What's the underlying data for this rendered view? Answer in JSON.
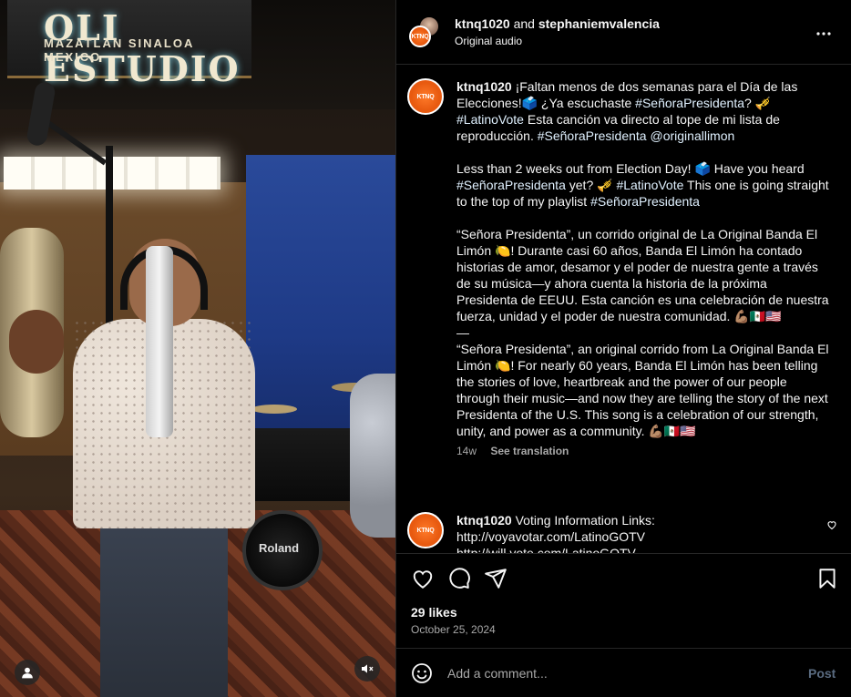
{
  "media": {
    "studio_sign_title": "OLI ESTUDIO",
    "studio_sign_subtitle": "MAZATLAN SINALOA MEXICO",
    "drum_brand": "Roland",
    "user_icon": "person-icon",
    "mute_icon": "speaker-muted-icon"
  },
  "header": {
    "user1": "ktnq1020",
    "joiner": "and",
    "user2": "stephaniemvalencia",
    "audio": "Original audio",
    "avatar_text": "KTNQ",
    "more_icon": "more-horizontal-icon"
  },
  "caption": {
    "user": "ktnq1020",
    "avatar_text": "KTNQ",
    "p1": [
      {
        "t": "text",
        "v": "¡Faltan menos de dos semanas para el Día de las Elecciones!🗳️ ¿Ya escuchaste "
      },
      {
        "t": "tag",
        "v": "#SeñoraPresidenta"
      },
      {
        "t": "text",
        "v": "? 🎺 "
      },
      {
        "t": "tag",
        "v": "#LatinoVote"
      },
      {
        "t": "text",
        "v": " Esta canción va directo al tope de mi lista de reproducción. "
      },
      {
        "t": "tag",
        "v": "#SeñoraPresidenta"
      },
      {
        "t": "text",
        "v": " "
      },
      {
        "t": "tag",
        "v": "@originallimon"
      }
    ],
    "p2": [
      {
        "t": "text",
        "v": "Less than 2 weeks out from Election Day! 🗳️ Have you heard "
      },
      {
        "t": "tag",
        "v": "#SeñoraPresidenta"
      },
      {
        "t": "text",
        "v": " yet? 🎺 "
      },
      {
        "t": "tag",
        "v": "#LatinoVote"
      },
      {
        "t": "text",
        "v": " This one is going straight to the top of my playlist "
      },
      {
        "t": "tag",
        "v": "#SeñoraPresidenta"
      }
    ],
    "p3": "“Señora Presidenta”, un corrido original de La Original Banda El Limón 🍋! Durante casi 60 años, Banda El Limón ha contado historias de amor, desamor y el poder de nuestra gente a través de su música—y ahora cuenta la historia de la próxima Presidenta de EEUU. Esta canción es una celebración de nuestra fuerza, unidad y el poder de nuestra comunidad. 💪🏽🇲🇽🇺🇸",
    "separator": "—",
    "p4": "“Señora Presidenta”, an original corrido from La Original Banda El Limón 🍋! For nearly 60 years, Banda El Limón has been telling the stories of love, heartbreak and the power of our people through their music—and now they are telling the story of the next Presidenta of the U.S. This song is a celebration of our strength, unity, and power as a community. 💪🏽🇲🇽🇺🇸",
    "age": "14w",
    "see_translation": "See translation"
  },
  "comment2": {
    "user": "ktnq1020",
    "avatar_text": "KTNQ",
    "text": "Voting Information Links:",
    "line2": "http://voyavotar.com/LatinoGOTV",
    "line3": "http://will.vote.com/LatinoGOTV"
  },
  "actions": {
    "like_icon": "heart-icon",
    "comment_icon": "comment-icon",
    "share_icon": "send-icon",
    "save_icon": "bookmark-icon",
    "likes": "29 likes",
    "date": "October 25, 2024"
  },
  "add_comment": {
    "emoji_icon": "smiley-icon",
    "placeholder": "Add a comment...",
    "post": "Post"
  }
}
